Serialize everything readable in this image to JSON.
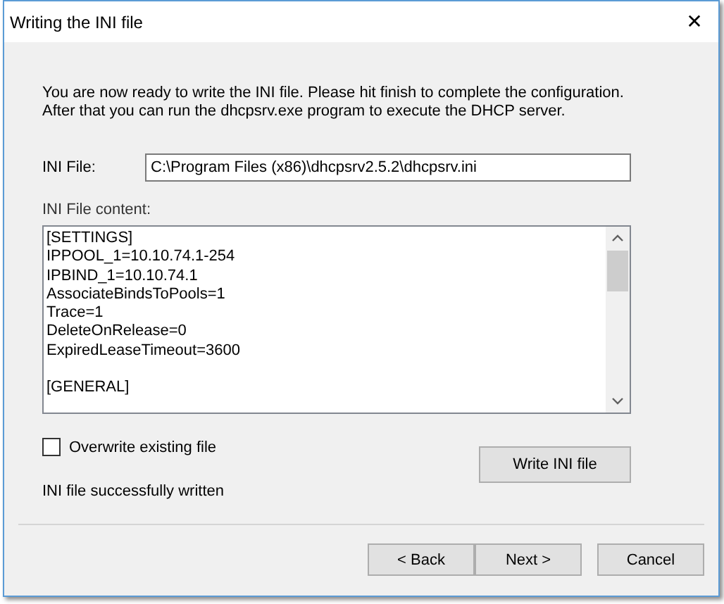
{
  "window": {
    "title": "Writing the INI file",
    "close_glyph": "✕"
  },
  "intro": [
    "You are now ready to write the INI file. Please hit finish to complete the configuration.",
    "After that you can run the dhcpsrv.exe program to execute the DHCP server."
  ],
  "ini_file": {
    "label": "INI File:",
    "value": "C:\\Program Files (x86)\\dhcpsrv2.5.2\\dhcpsrv.ini"
  },
  "content": {
    "label": "INI File content:",
    "sections": [
      {
        "lines": [
          "[SETTINGS]",
          "IPPOOL_1=10.10.74.1-254",
          "IPBIND_1=10.10.74.1",
          "AssociateBindsToPools=1",
          "Trace=1",
          "DeleteOnRelease=0",
          "ExpiredLeaseTimeout=3600"
        ]
      },
      {
        "lines": [
          "[GENERAL]"
        ]
      }
    ]
  },
  "overwrite": {
    "label": "Overwrite existing file",
    "checked": false
  },
  "write_button": "Write INI file",
  "status": "INI file successfully written",
  "buttons": [
    {
      "label": "< Back"
    },
    {
      "label": "Next >"
    },
    {
      "label": "Cancel"
    }
  ]
}
